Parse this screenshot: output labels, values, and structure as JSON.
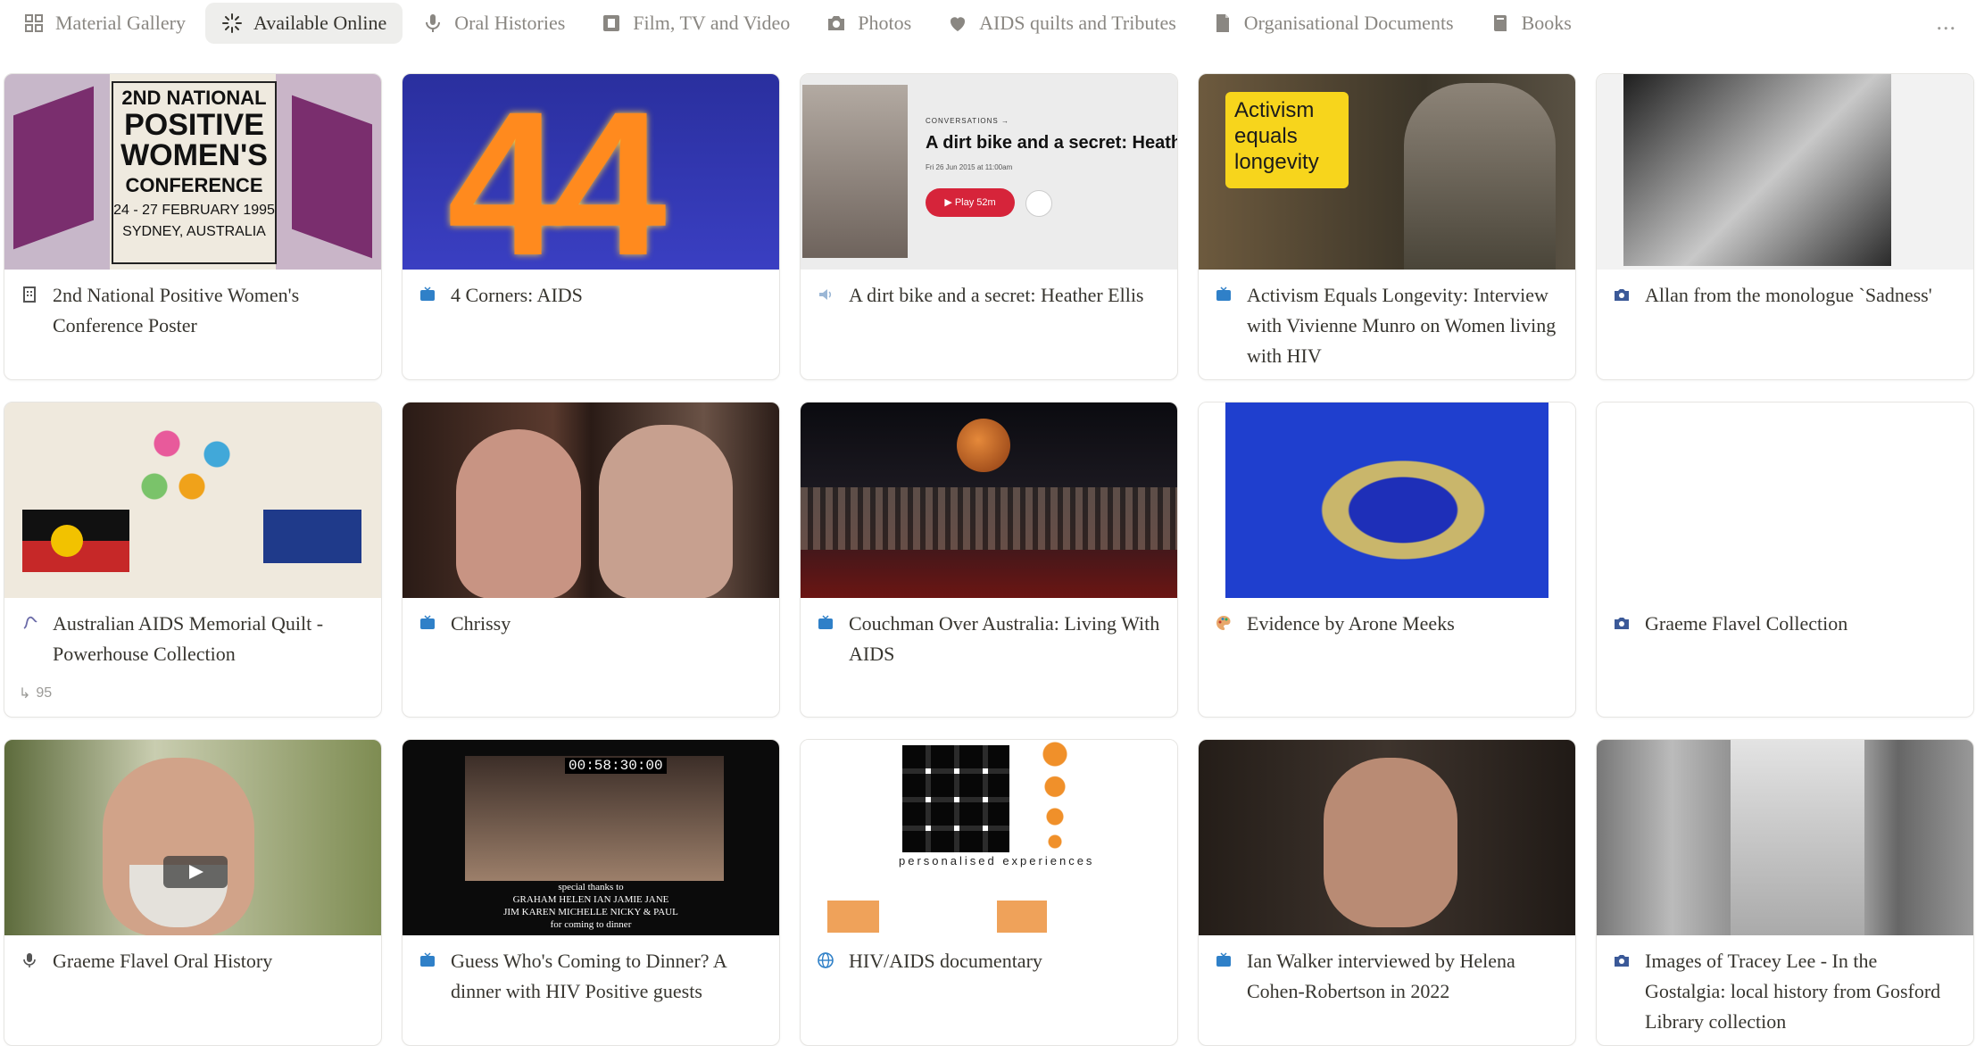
{
  "tabs": [
    {
      "label": "Material Gallery",
      "icon": "grid-icon",
      "active": false
    },
    {
      "label": "Available Online",
      "icon": "sparkle-icon",
      "active": true
    },
    {
      "label": "Oral Histories",
      "icon": "microphone-icon",
      "active": false
    },
    {
      "label": "Film, TV and Video",
      "icon": "film-icon",
      "active": false
    },
    {
      "label": "Photos",
      "icon": "camera-icon",
      "active": false
    },
    {
      "label": "AIDS quilts and Tributes",
      "icon": "heart-icon",
      "active": false
    },
    {
      "label": "Organisational Documents",
      "icon": "document-icon",
      "active": false
    },
    {
      "label": "Books",
      "icon": "book-icon",
      "active": false
    }
  ],
  "more_label": "...",
  "cards": [
    {
      "title": "2nd National Positive Women's Conference Poster",
      "icon": "building-icon",
      "thumb": {
        "line1": "2ND NATIONAL",
        "line2": "POSITIVE",
        "line3": "WOMEN'S",
        "line4": "CONFERENCE",
        "line5": "24 - 27 FEBRUARY 1995",
        "line6": "SYDNEY, AUSTRALIA"
      }
    },
    {
      "title": "4 Corners: AIDS",
      "icon": "tv-icon",
      "thumb": {
        "text": "44"
      }
    },
    {
      "title": "A dirt bike and a secret: Heather Ellis",
      "icon": "speaker-icon",
      "thumb": {
        "kicker": "CONVERSATIONS →",
        "headline": "A dirt bike and a secret: Heath",
        "date": "Fri 26 Jun 2015 at 11:00am",
        "play": "▶ Play 52m"
      }
    },
    {
      "title": "Activism Equals Longevity: Interview with Vivienne Munro on Women living with HIV",
      "icon": "tv-icon",
      "thumb": {
        "sign": "Activism equals longevity"
      }
    },
    {
      "title": "Allan from the monologue `Sadness'",
      "icon": "camera-icon",
      "thumb": {}
    },
    {
      "title": "Australian AIDS Memorial Quilt - Powerhouse Collection",
      "icon": "strand-icon",
      "count": "95",
      "thumb": {}
    },
    {
      "title": "Chrissy",
      "icon": "tv-icon",
      "thumb": {}
    },
    {
      "title": "Couchman Over Australia: Living With AIDS",
      "icon": "tv-icon",
      "thumb": {}
    },
    {
      "title": "Evidence by Arone Meeks",
      "icon": "palette-icon",
      "thumb": {}
    },
    {
      "title": "Graeme Flavel Collection",
      "icon": "camera-icon",
      "thumb": {}
    },
    {
      "title": "Graeme Flavel Oral History",
      "icon": "microphone-icon",
      "thumb": {}
    },
    {
      "title": "Guess Who's Coming to Dinner? A dinner with HIV Positive guests",
      "icon": "tv-icon",
      "thumb": {
        "timecode": "00:58:30:00",
        "caption1": "special thanks to",
        "caption2": "GRAHAM HELEN IAN JAMIE JANE",
        "caption3": "JIM KAREN MICHELLE NICKY & PAUL",
        "caption4": "for coming to dinner"
      }
    },
    {
      "title": "HIV/AIDS documentary",
      "icon": "globe-icon",
      "thumb": {
        "tagline": "personalised experiences"
      }
    },
    {
      "title": "Ian Walker interviewed by Helena Cohen-Robertson in 2022",
      "icon": "tv-icon",
      "thumb": {}
    },
    {
      "title": "Images of Tracey Lee - In the Gostalgia: local history from Gosford Library collection",
      "icon": "camera-icon",
      "thumb": {}
    }
  ],
  "colors": {
    "active_tab_bg": "#eeeeec",
    "text": "#37352f",
    "muted": "#8a8782",
    "tv_blue": "#2f80c8"
  }
}
